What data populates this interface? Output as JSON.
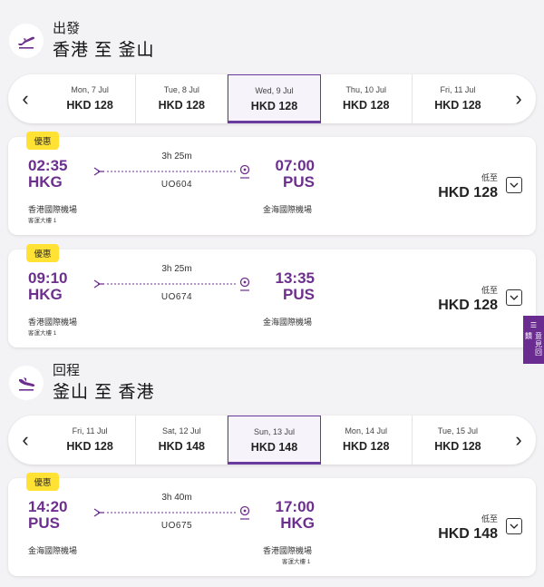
{
  "outbound": {
    "label": "出發",
    "route": "香港 至 釜山",
    "dates": [
      {
        "label": "Mon, 7 Jul",
        "price": "HKD 128",
        "selected": false
      },
      {
        "label": "Tue, 8 Jul",
        "price": "HKD 128",
        "selected": false
      },
      {
        "label": "Wed, 9 Jul",
        "price": "HKD 128",
        "selected": true
      },
      {
        "label": "Thu, 10 Jul",
        "price": "HKD 128",
        "selected": false
      },
      {
        "label": "Fri, 11 Jul",
        "price": "HKD 128",
        "selected": false
      }
    ],
    "flights": [
      {
        "badge": "優惠",
        "dep_time": "02:35",
        "dep_code": "HKG",
        "dep_airport": "香港國際機場",
        "dep_terminal": "客運大樓 1",
        "duration": "3h 25m",
        "flight_no": "UO604",
        "arr_time": "07:00",
        "arr_code": "PUS",
        "arr_airport": "金海國際機場",
        "arr_terminal": "",
        "low_label": "低至",
        "price": "HKD 128"
      },
      {
        "badge": "優惠",
        "dep_time": "09:10",
        "dep_code": "HKG",
        "dep_airport": "香港國際機場",
        "dep_terminal": "客運大樓 1",
        "duration": "3h 25m",
        "flight_no": "UO674",
        "arr_time": "13:35",
        "arr_code": "PUS",
        "arr_airport": "金海國際機場",
        "arr_terminal": "",
        "low_label": "低至",
        "price": "HKD 128"
      }
    ]
  },
  "return": {
    "label": "回程",
    "route": "釜山 至 香港",
    "dates": [
      {
        "label": "Fri, 11 Jul",
        "price": "HKD 128",
        "selected": false
      },
      {
        "label": "Sat, 12 Jul",
        "price": "HKD 148",
        "selected": false
      },
      {
        "label": "Sun, 13 Jul",
        "price": "HKD 148",
        "selected": true
      },
      {
        "label": "Mon, 14 Jul",
        "price": "HKD 128",
        "selected": false
      },
      {
        "label": "Tue, 15 Jul",
        "price": "HKD 128",
        "selected": false
      }
    ],
    "flights": [
      {
        "badge": "優惠",
        "dep_time": "14:20",
        "dep_code": "PUS",
        "dep_airport": "金海國際機場",
        "dep_terminal": "",
        "duration": "3h 40m",
        "flight_no": "UO675",
        "arr_time": "17:00",
        "arr_code": "HKG",
        "arr_airport": "香港國際機場",
        "arr_terminal": "客運大樓 1",
        "low_label": "低至",
        "price": "HKD 148"
      }
    ]
  },
  "side_tab": {
    "label": "意見回饋"
  },
  "colors": {
    "accent": "#6d2f8e",
    "badge": "#ffe234",
    "side_tab": "#6b2c91"
  }
}
